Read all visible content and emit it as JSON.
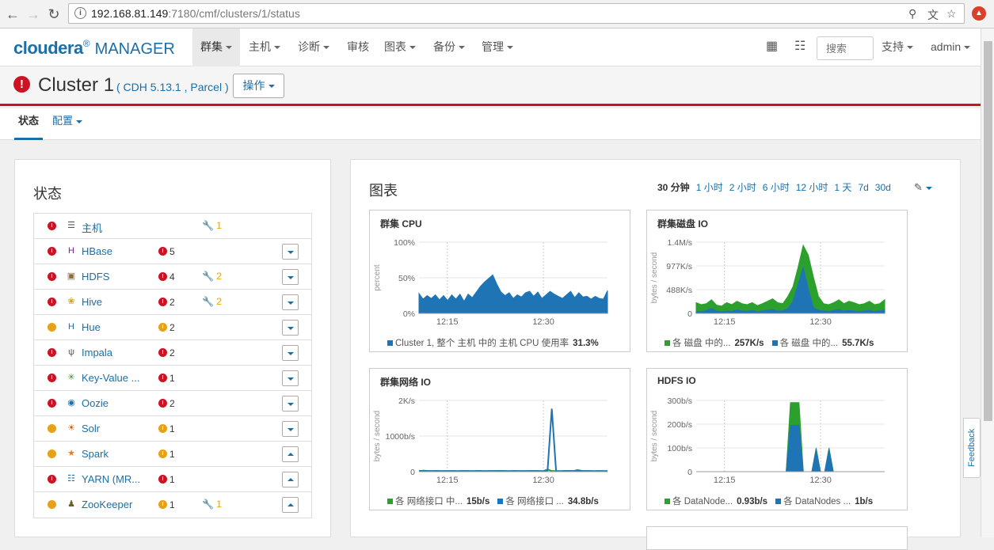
{
  "browser": {
    "url_host": "192.168.81.149",
    "url_rest": ":7180/cmf/clusters/1/status"
  },
  "topnav": {
    "logo_bold": "cloudera",
    "logo_light": "MANAGER",
    "menu": [
      "群集",
      "主机",
      "诊断",
      "审核",
      "图表",
      "备份",
      "管理"
    ],
    "search_placeholder": "搜索",
    "support": "支持",
    "user": "admin"
  },
  "header": {
    "cluster_name": "Cluster 1",
    "cluster_version": "( CDH 5.13.1 , Parcel )",
    "ops_label": "操作"
  },
  "subnav": {
    "tab_status": "状态",
    "tab_config": "配置"
  },
  "status_panel": {
    "title": "状态",
    "services": [
      {
        "name": "主机",
        "health": "bad",
        "alerts": null,
        "alert_type": null,
        "config": "1",
        "dropdown": null,
        "icon": "list-icon"
      },
      {
        "name": "HBase",
        "health": "bad",
        "alerts": "5",
        "alert_type": "bad",
        "config": null,
        "dropdown": "down",
        "icon": "hbase-icon"
      },
      {
        "name": "HDFS",
        "health": "bad",
        "alerts": "4",
        "alert_type": "bad",
        "config": "2",
        "dropdown": "down",
        "icon": "hdfs-icon"
      },
      {
        "name": "Hive",
        "health": "bad",
        "alerts": "2",
        "alert_type": "bad",
        "config": "2",
        "dropdown": "down",
        "icon": "hive-icon"
      },
      {
        "name": "Hue",
        "health": "warn",
        "alerts": "2",
        "alert_type": "warn",
        "config": null,
        "dropdown": "down",
        "icon": "hue-icon"
      },
      {
        "name": "Impala",
        "health": "bad",
        "alerts": "2",
        "alert_type": "bad",
        "config": null,
        "dropdown": "down",
        "icon": "impala-icon"
      },
      {
        "name": "Key-Value ...",
        "health": "bad",
        "alerts": "1",
        "alert_type": "bad",
        "config": null,
        "dropdown": "down",
        "icon": "key-value-icon"
      },
      {
        "name": "Oozie",
        "health": "bad",
        "alerts": "2",
        "alert_type": "bad",
        "config": null,
        "dropdown": "down",
        "icon": "oozie-icon"
      },
      {
        "name": "Solr",
        "health": "warn",
        "alerts": "1",
        "alert_type": "warn",
        "config": null,
        "dropdown": "down",
        "icon": "solr-icon"
      },
      {
        "name": "Spark",
        "health": "warn",
        "alerts": "1",
        "alert_type": "warn",
        "config": null,
        "dropdown": "up",
        "icon": "spark-icon"
      },
      {
        "name": "YARN (MR...",
        "health": "bad",
        "alerts": "1",
        "alert_type": "bad",
        "config": null,
        "dropdown": "up",
        "icon": "yarn-icon"
      },
      {
        "name": "ZooKeeper",
        "health": "warn",
        "alerts": "1",
        "alert_type": "warn",
        "config": "1",
        "dropdown": "up",
        "icon": "zookeeper-icon"
      }
    ]
  },
  "charts_panel": {
    "title": "图表",
    "time_ranges": [
      "30 分钟",
      "1 小时",
      "2 小时",
      "6 小时",
      "12 小时",
      "1 天",
      "7d",
      "30d"
    ],
    "selected_range": "30 分钟",
    "colors": {
      "blue": "#1f74b5",
      "green": "#2ca02c"
    }
  },
  "chart_data": [
    {
      "type": "area",
      "title": "群集 CPU",
      "ylabel": "percent",
      "yticks": [
        "100%",
        "50%",
        "0%"
      ],
      "ylim": [
        0,
        100
      ],
      "xticks": [
        "12:15",
        "12:30"
      ],
      "series": [
        {
          "name": "Cluster 1, 整个 主机 中的 主机 CPU 使用率",
          "color": "#1f74b5",
          "latest": "31.3%",
          "values": [
            28,
            20,
            25,
            21,
            26,
            19,
            25,
            18,
            26,
            20,
            27,
            17,
            27,
            22,
            30,
            38,
            44,
            49,
            54,
            41,
            30,
            25,
            29,
            21,
            26,
            23,
            29,
            31,
            24,
            30,
            21,
            26,
            31,
            27,
            24,
            21,
            26,
            31,
            22,
            29,
            23,
            24,
            20,
            24,
            21,
            20,
            32
          ]
        }
      ]
    },
    {
      "type": "area",
      "title": "群集磁盘 IO",
      "ylabel": "bytes / second",
      "yticks": [
        "1.4M/s",
        "977K/s",
        "488K/s",
        "0"
      ],
      "ylim": [
        0,
        1.465
      ],
      "xticks": [
        "12:15",
        "12:30"
      ],
      "series": [
        {
          "name": "各 磁盘 中的...",
          "color": "#2ca02c",
          "latest": "257K/s",
          "values": [
            0.22,
            0.18,
            0.2,
            0.28,
            0.17,
            0.15,
            0.22,
            0.18,
            0.25,
            0.2,
            0.18,
            0.22,
            0.16,
            0.2,
            0.25,
            0.3,
            0.22,
            0.2,
            0.35,
            0.55,
            0.95,
            1.4,
            1.2,
            0.75,
            0.35,
            0.2,
            0.18,
            0.22,
            0.28,
            0.2,
            0.25,
            0.22,
            0.18,
            0.2,
            0.25,
            0.18,
            0.2,
            0.28
          ]
        },
        {
          "name": "各 磁盘 中的...",
          "color": "#1f74b5",
          "latest": "55.7K/s",
          "values": [
            0.04,
            0.03,
            0.06,
            0.1,
            0.05,
            0.03,
            0.05,
            0.04,
            0.07,
            0.05,
            0.04,
            0.06,
            0.03,
            0.05,
            0.07,
            0.08,
            0.05,
            0.05,
            0.1,
            0.25,
            0.6,
            0.95,
            0.5,
            0.12,
            0.06,
            0.05,
            0.04,
            0.06,
            0.08,
            0.05,
            0.06,
            0.05,
            0.04,
            0.05,
            0.06,
            0.04,
            0.05,
            0.07
          ]
        }
      ]
    },
    {
      "type": "line",
      "title": "群集网络 IO",
      "ylabel": "bytes / second",
      "yticks": [
        "2K/s",
        "1000b/s",
        "0"
      ],
      "ylim": [
        0,
        2600
      ],
      "xticks": [
        "12:15",
        "12:30"
      ],
      "series": [
        {
          "name": "各 网络接口 中...",
          "color": "#2ca02c",
          "latest": "15b/s",
          "values": [
            15,
            40,
            25,
            20,
            30,
            20,
            15,
            25,
            20,
            15,
            20,
            25,
            15,
            20,
            30,
            20,
            15,
            25,
            20,
            30,
            20,
            15,
            25,
            20,
            15,
            20,
            25,
            30,
            20,
            15,
            80,
            25,
            20,
            15,
            25,
            30,
            20,
            60,
            30,
            25,
            20,
            15,
            20,
            20,
            15
          ]
        },
        {
          "name": "各 网络接口 ...",
          "color": "#1f74b5",
          "latest": "34.8b/s",
          "values": [
            30,
            20,
            25,
            20,
            25,
            20,
            25,
            20,
            25,
            20,
            25,
            20,
            25,
            20,
            25,
            20,
            25,
            20,
            25,
            20,
            25,
            20,
            25,
            20,
            25,
            20,
            25,
            20,
            25,
            20,
            25,
            2300,
            25,
            20,
            25,
            20,
            25,
            20,
            25,
            20,
            25,
            20,
            25,
            20,
            25
          ]
        }
      ]
    },
    {
      "type": "area",
      "title": "HDFS IO",
      "ylabel": "bytes / second",
      "yticks": [
        "300b/s",
        "200b/s",
        "100b/s",
        "0"
      ],
      "ylim": [
        0,
        330
      ],
      "xticks": [
        "12:15",
        "12:30"
      ],
      "series": [
        {
          "name": "各 DataNode...",
          "color": "#2ca02c",
          "latest": "0.93b/s",
          "values": [
            0,
            0,
            0,
            0,
            0,
            0,
            0,
            0,
            0,
            0,
            0,
            0,
            0,
            0,
            0,
            0,
            0,
            0,
            0,
            0,
            0,
            0,
            320,
            320,
            320,
            0,
            0,
            0,
            110,
            0,
            0,
            110,
            0,
            0,
            0,
            0,
            0,
            0,
            0,
            0,
            0,
            0,
            0,
            0,
            0
          ]
        },
        {
          "name": "各 DataNodes ...",
          "color": "#1f74b5",
          "latest": "1b/s",
          "values": [
            0,
            0,
            0,
            0,
            0,
            0,
            0,
            0,
            0,
            0,
            0,
            0,
            0,
            0,
            0,
            0,
            0,
            0,
            0,
            0,
            0,
            0,
            215,
            215,
            215,
            0,
            0,
            0,
            105,
            0,
            0,
            105,
            0,
            0,
            0,
            0,
            0,
            0,
            0,
            0,
            0,
            0,
            0,
            0,
            0
          ]
        }
      ]
    }
  ],
  "feedback": "Feedback"
}
